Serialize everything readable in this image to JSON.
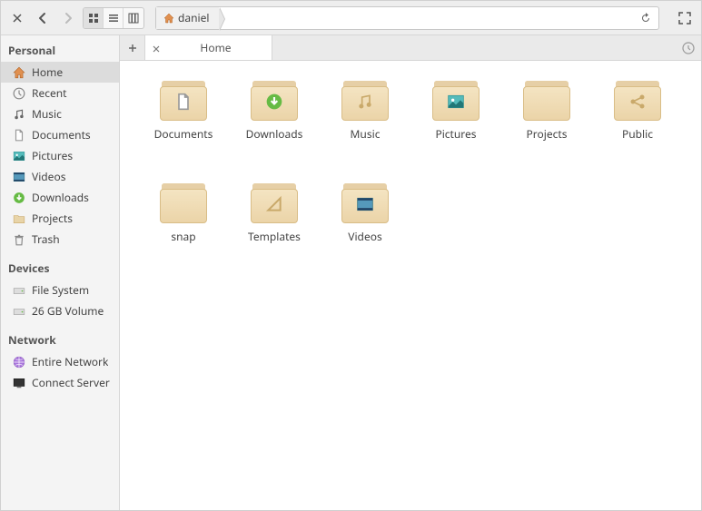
{
  "breadcrumb": {
    "root": "daniel"
  },
  "tabs": {
    "active_label": "Home"
  },
  "sidebar": {
    "sections": [
      {
        "heading": "Personal",
        "items": [
          {
            "id": "home",
            "label": "Home",
            "icon": "home",
            "active": true
          },
          {
            "id": "recent",
            "label": "Recent",
            "icon": "clock"
          },
          {
            "id": "music",
            "label": "Music",
            "icon": "note"
          },
          {
            "id": "documents",
            "label": "Documents",
            "icon": "doc"
          },
          {
            "id": "pictures",
            "label": "Pictures",
            "icon": "pic"
          },
          {
            "id": "videos",
            "label": "Videos",
            "icon": "video"
          },
          {
            "id": "downloads",
            "label": "Downloads",
            "icon": "download"
          },
          {
            "id": "projects",
            "label": "Projects",
            "icon": "folder"
          },
          {
            "id": "trash",
            "label": "Trash",
            "icon": "trash"
          }
        ]
      },
      {
        "heading": "Devices",
        "items": [
          {
            "id": "filesystem",
            "label": "File System",
            "icon": "drive"
          },
          {
            "id": "volume26",
            "label": "26 GB Volume",
            "icon": "drive"
          }
        ]
      },
      {
        "heading": "Network",
        "items": [
          {
            "id": "network",
            "label": "Entire Network",
            "icon": "globe"
          },
          {
            "id": "connect",
            "label": "Connect Server",
            "icon": "monitor"
          }
        ]
      }
    ]
  },
  "files": [
    {
      "name": "Documents",
      "glyph": "doc"
    },
    {
      "name": "Downloads",
      "glyph": "download"
    },
    {
      "name": "Music",
      "glyph": "note"
    },
    {
      "name": "Pictures",
      "glyph": "pic"
    },
    {
      "name": "Projects",
      "glyph": "folder"
    },
    {
      "name": "Public",
      "glyph": "share"
    },
    {
      "name": "snap",
      "glyph": "folder"
    },
    {
      "name": "Templates",
      "glyph": "template"
    },
    {
      "name": "Videos",
      "glyph": "video"
    }
  ]
}
